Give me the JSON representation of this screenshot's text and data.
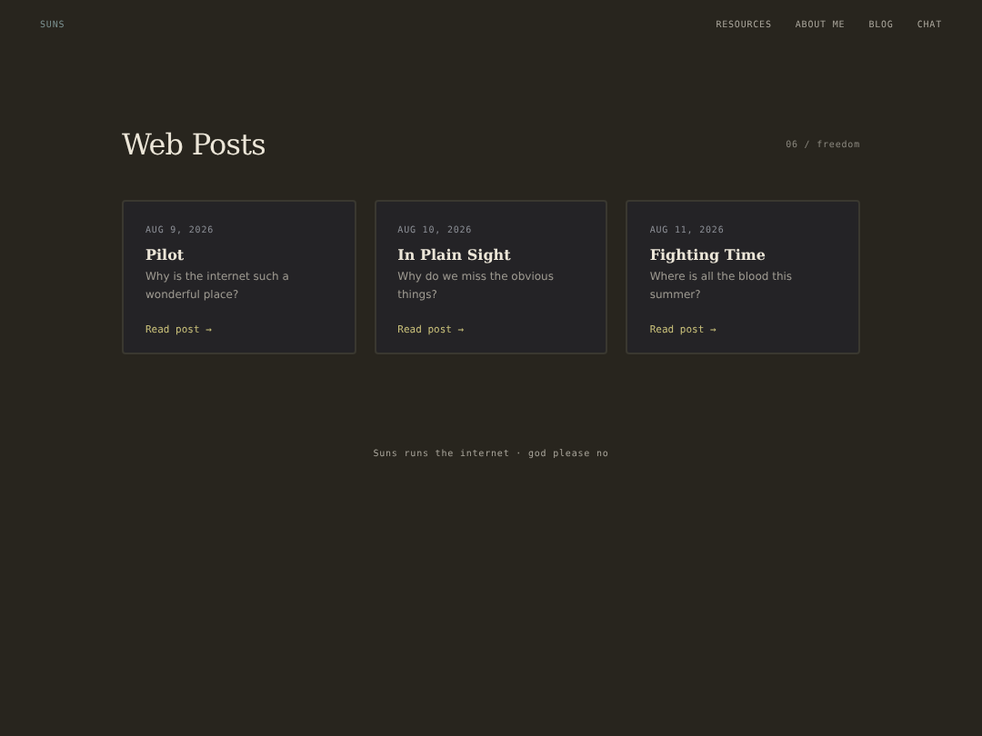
{
  "header": {
    "logo": "SUNS",
    "nav": [
      "RESOURCES",
      "ABOUT ME",
      "BLOG",
      "CHAT"
    ]
  },
  "page": {
    "title": "Web Posts",
    "breadcrumb": "06 / freedom"
  },
  "posts": [
    {
      "date": "AUG 9, 2026",
      "title": "Pilot",
      "summary": "Why is the internet such a wonderful place?",
      "link": "Read post →"
    },
    {
      "date": "AUG 10, 2026",
      "title": "In Plain Sight",
      "summary": "Why do we miss the obvious things?",
      "link": "Read post →"
    },
    {
      "date": "AUG 11, 2026",
      "title": "Fighting Time",
      "summary": "Where is all the blood this summer?",
      "link": "Read post →"
    }
  ],
  "footer": "Suns runs the internet · god please no"
}
